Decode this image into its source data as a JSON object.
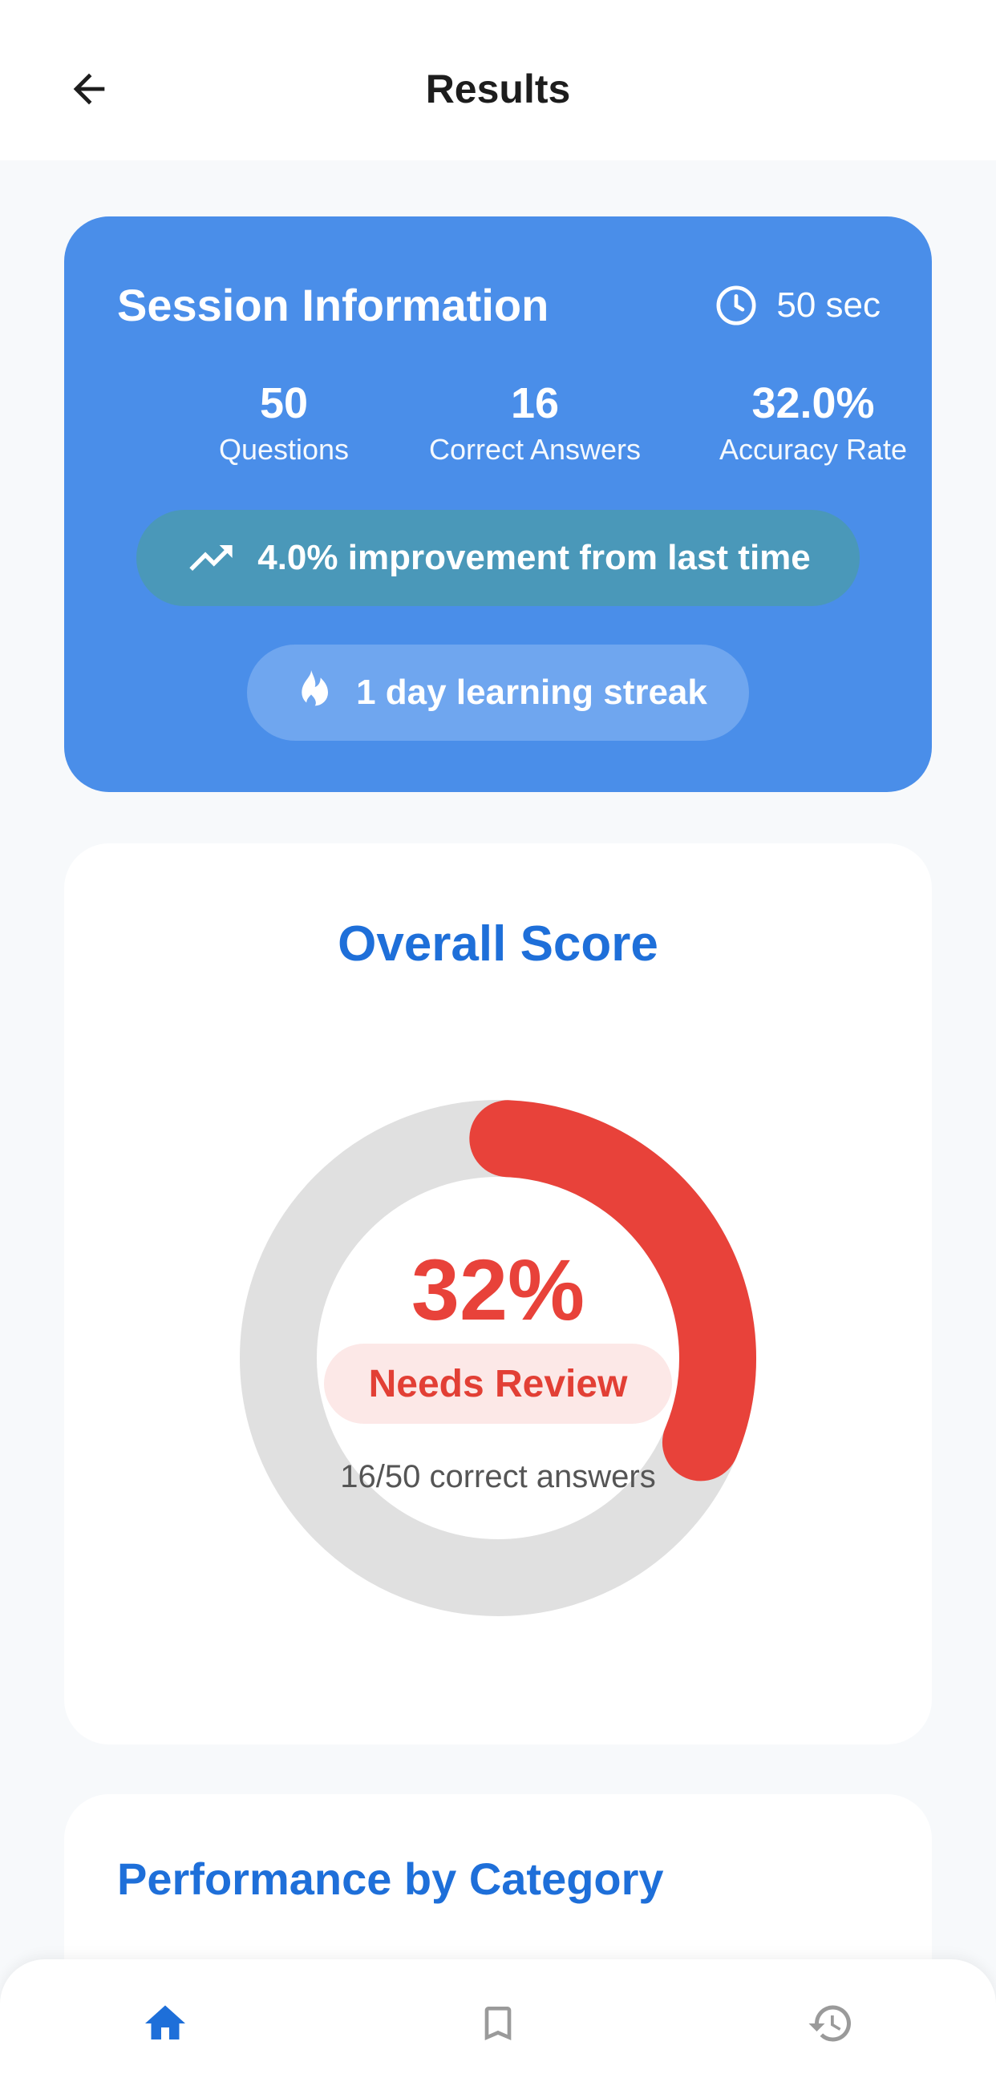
{
  "header": {
    "title": "Results",
    "back_icon": "arrow-back-icon"
  },
  "session": {
    "title": "Session Information",
    "time_icon": "clock-icon",
    "time": "50 sec",
    "stats": [
      {
        "value": "50",
        "label": "Questions"
      },
      {
        "value": "16",
        "label": "Correct Answers"
      },
      {
        "value": "32.0%",
        "label": "Accuracy Rate"
      }
    ],
    "improvement_icon": "trending-up-icon",
    "improvement": "4.0% improvement from last time",
    "streak_icon": "flame-icon",
    "streak": "1 day learning streak"
  },
  "overall": {
    "title": "Overall Score",
    "percent_text": "32%",
    "score_fraction": 0.32,
    "status": "Needs Review",
    "correct_text": "16/50 correct answers"
  },
  "performance": {
    "title": "Performance by Category"
  },
  "nav": {
    "items": [
      {
        "icon": "home-icon",
        "active": true
      },
      {
        "icon": "bookmark-icon",
        "active": false
      },
      {
        "icon": "history-icon",
        "active": false
      }
    ]
  },
  "colors": {
    "primary": "#4a8ee9",
    "accent_blue": "#1e6fd9",
    "score_red": "#e8423a",
    "track_gray": "#e0e0e0",
    "improve_pill": "#4a98b9",
    "streak_pill": "#6fa6ef"
  }
}
